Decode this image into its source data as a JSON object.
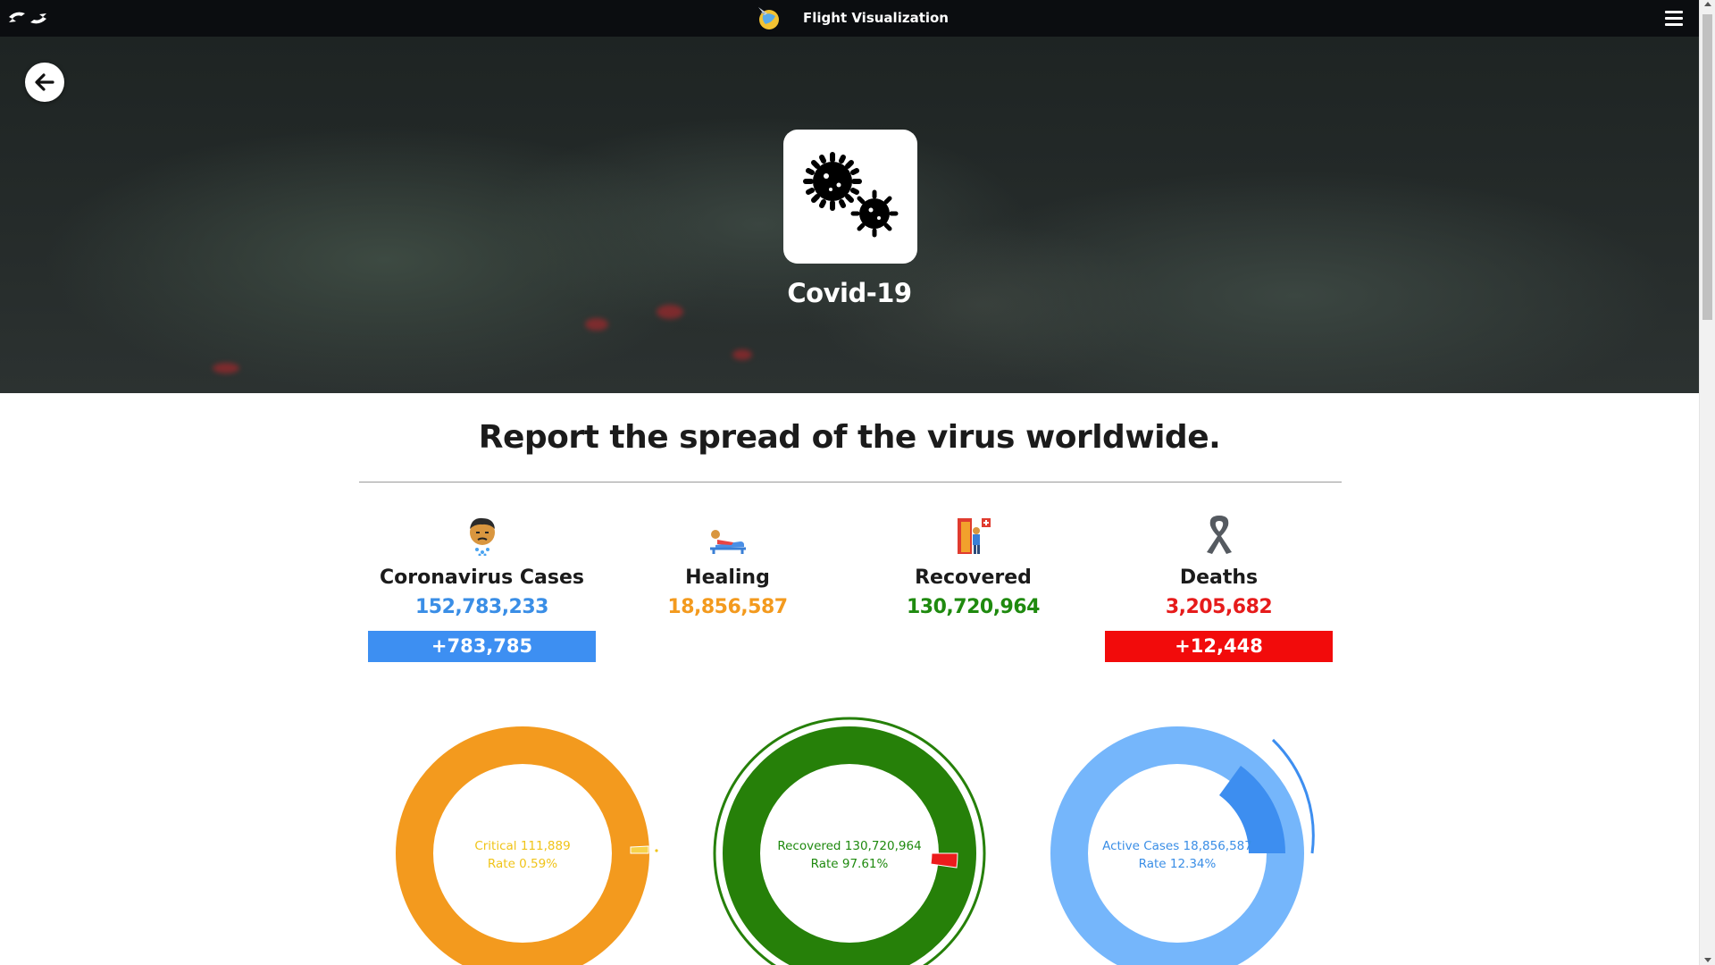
{
  "topbar": {
    "title": "Flight Visualization",
    "logo_icon": "globe-plane-icon",
    "left_icon": "flight-arrows-icon",
    "menu_icon": "hamburger-menu-icon"
  },
  "hero": {
    "title": "Covid-19",
    "tile_icon": "virus-icon",
    "back_icon": "arrow-left-icon"
  },
  "report": {
    "heading": "Report the spread of the virus worldwide."
  },
  "stats": [
    {
      "label": "Coronavirus Cases",
      "value": "152,783,233",
      "delta": "+783,785",
      "color": "#3a8ee6",
      "delta_bg": "#3d8ff2",
      "icon": "sick-person-icon"
    },
    {
      "label": "Healing",
      "value": "18,856,587",
      "delta": "",
      "color": "#f39a1e",
      "icon": "patient-bed-icon"
    },
    {
      "label": "Recovered",
      "value": "130,720,964",
      "delta": "",
      "color": "#1f8a0f",
      "icon": "hospital-exit-icon"
    },
    {
      "label": "Deaths",
      "value": "3,205,682",
      "delta": "+12,448",
      "color": "#e61b1b",
      "delta_bg": "#f20b0b",
      "icon": "ribbon-icon"
    }
  ],
  "donuts": [
    {
      "line1": "Critical 111,889",
      "line2": "Rate 0.59%",
      "rate": 0.59,
      "text_color": "#f0c419",
      "base_color": "#f39a1e",
      "highlight_color": "#f7d24a"
    },
    {
      "line1": "Recovered 130,720,964",
      "line2": "Rate 97.61%",
      "rate": 97.61,
      "text_color": "#1f8a0f",
      "base_color": "#ec1c1c",
      "highlight_color": "#268009"
    },
    {
      "line1": "Active Cases 18,856,587",
      "line2": "Rate 12.34%",
      "rate": 12.34,
      "text_color": "#3a8ee6",
      "base_color": "#75b6fb",
      "highlight_color": "#3d8ef0"
    }
  ]
}
